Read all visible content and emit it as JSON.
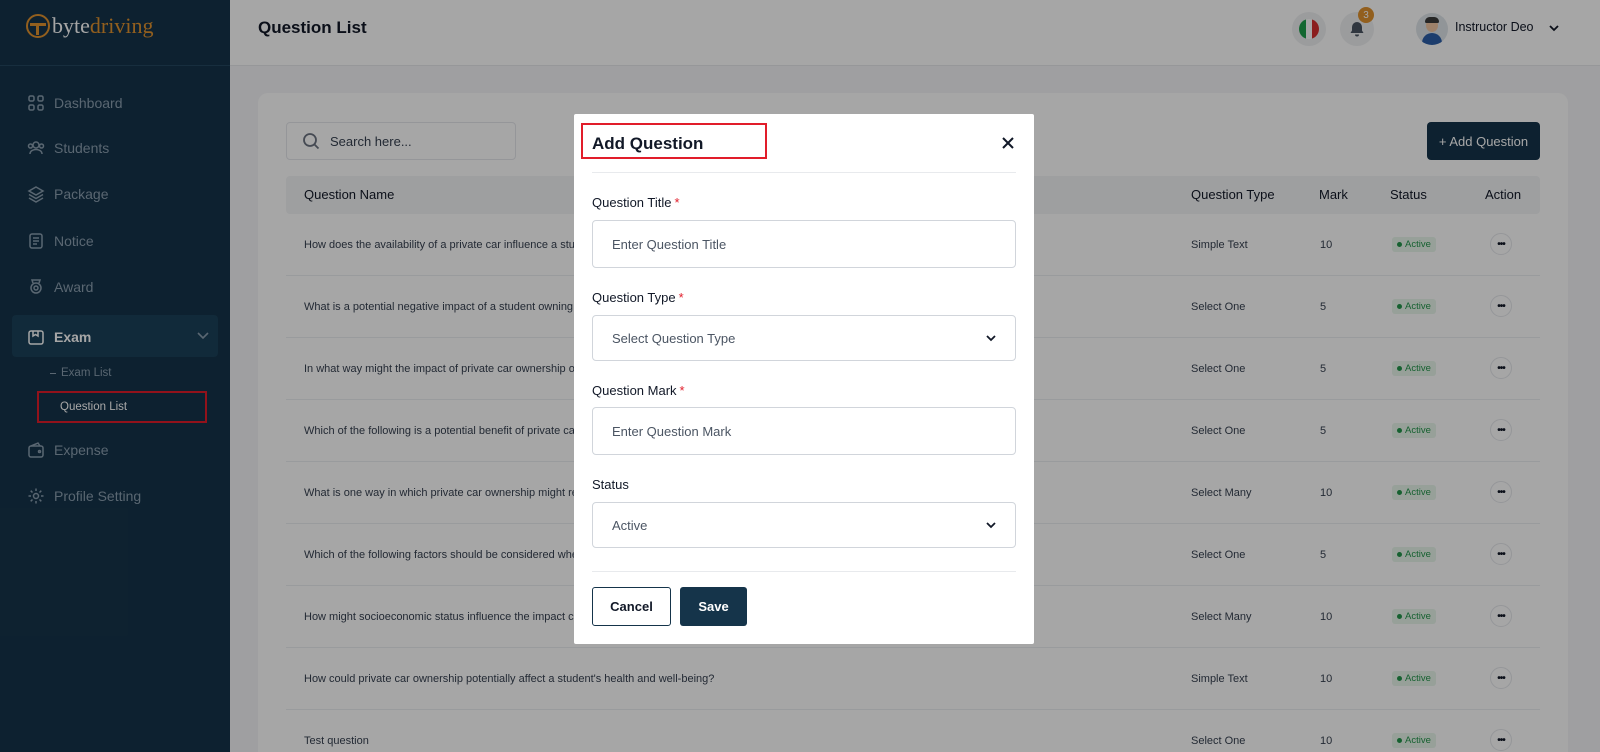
{
  "brand": {
    "part1": "byte",
    "part2": "driving"
  },
  "sidebar": {
    "items": [
      {
        "label": "Dashboard",
        "icon": "dashboard-icon"
      },
      {
        "label": "Students",
        "icon": "users-icon"
      },
      {
        "label": "Package",
        "icon": "layers-icon"
      },
      {
        "label": "Notice",
        "icon": "notice-icon"
      },
      {
        "label": "Award",
        "icon": "award-icon"
      },
      {
        "label": "Exam",
        "icon": "exam-icon"
      },
      {
        "label": "Expense",
        "icon": "wallet-icon"
      },
      {
        "label": "Profile Setting",
        "icon": "gear-icon"
      }
    ],
    "exam_sub": [
      "Exam List",
      "Question List"
    ],
    "active": "Question List"
  },
  "header": {
    "title": "Question List",
    "notification_count": "3",
    "user_name": "Instructor Deo"
  },
  "toolbar": {
    "search_placeholder": "Search here...",
    "add_label": "+ Add Question"
  },
  "table": {
    "columns": [
      "Question Name",
      "Question Type",
      "Mark",
      "Status",
      "Action"
    ],
    "rows": [
      {
        "name": "How does the availability of a private car influence a stud",
        "type": "Simple Text",
        "mark": "10",
        "status": "Active"
      },
      {
        "name": "What is a potential negative impact of a student owning",
        "type": "Select One",
        "mark": "5",
        "status": "Active"
      },
      {
        "name": "In what way might the impact of private car ownership o",
        "type": "Select One",
        "mark": "5",
        "status": "Active"
      },
      {
        "name": "Which of the following is a potential benefit of private ca",
        "type": "Select One",
        "mark": "5",
        "status": "Active"
      },
      {
        "name": "What is one way in which private car ownership might re",
        "type": "Select Many",
        "mark": "10",
        "status": "Active"
      },
      {
        "name": "Which of the following factors should be considered whe",
        "type": "Select One",
        "mark": "5",
        "status": "Active"
      },
      {
        "name": "How might socioeconomic status influence the impact c",
        "type": "Select Many",
        "mark": "10",
        "status": "Active"
      },
      {
        "name": "How could private car ownership potentially affect a student's health and well-being?",
        "type": "Simple Text",
        "mark": "10",
        "status": "Active"
      },
      {
        "name": "Test question",
        "type": "Select One",
        "mark": "10",
        "status": "Active"
      }
    ]
  },
  "modal": {
    "title": "Add Question",
    "fields": {
      "title": {
        "label": "Question Title",
        "placeholder": "Enter Question Title"
      },
      "type": {
        "label": "Question Type",
        "value": "Select Question Type"
      },
      "mark": {
        "label": "Question Mark",
        "placeholder": "Enter Question Mark"
      },
      "status": {
        "label": "Status",
        "value": "Active"
      }
    },
    "required_mark": "*",
    "cancel_label": "Cancel",
    "save_label": "Save"
  },
  "colors": {
    "sidebar_bg": "#15344a",
    "accent": "#e0922f",
    "primary_button": "#15344a",
    "highlight": "#e11d2a",
    "status_green": "#23954a"
  }
}
